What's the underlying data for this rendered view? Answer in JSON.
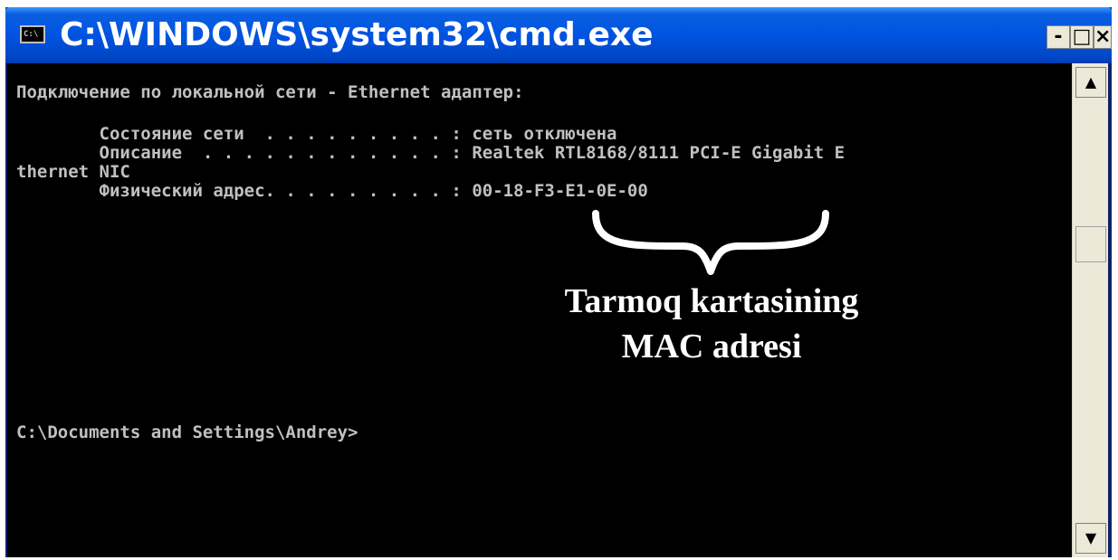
{
  "window": {
    "title": "C:\\WINDOWS\\system32\\cmd.exe",
    "icon": "cmd-icon",
    "icon_label": "C:\\",
    "buttons": {
      "minimize": "-",
      "maximize": "□",
      "close": "×"
    }
  },
  "console": {
    "lines": [
      "Подключение по локальной сети - Ethernet адаптер:",
      "        Состояние сети  . . . . . . . . . : сеть отключена",
      "        Описание  . . . . . . . . . . . . : Realtek RTL8168/8111 PCI-E Gigabit E",
      "thernet NIC",
      "        Физический адрес. . . . . . . . . : 00-18-F3-E1-0E-00",
      "C:\\Documents and Settings\\Andrey>"
    ]
  },
  "annotation": {
    "line1": "Tarmoq kartasining",
    "line2": "MAC adresi"
  },
  "scrollbar": {
    "up": "▲",
    "down": "▼"
  },
  "colors": {
    "titlebar": "#0053e1",
    "console_bg": "#000000",
    "console_text": "#c0c0c0",
    "annotation": "#ffffff"
  }
}
